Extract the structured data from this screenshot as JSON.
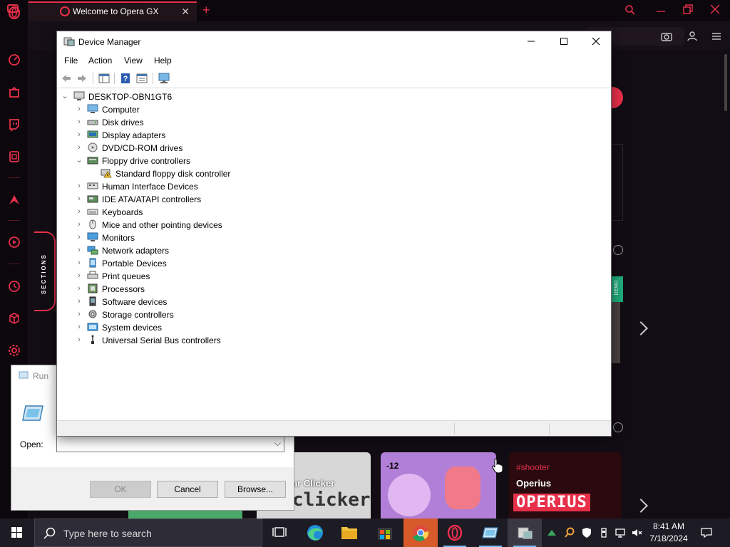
{
  "browser": {
    "tab_title": "Welcome to Opera GX",
    "sections_label": "SECTIONS",
    "demo_badge": "DEMO",
    "cards": [
      {
        "title": "ar Clicker",
        "logo_text": "clicker"
      },
      {
        "number": "-12"
      },
      {
        "tag": "#shooter",
        "title": "Operius",
        "logo_text": "OPERIUS"
      }
    ]
  },
  "device_manager": {
    "title": "Device Manager",
    "menu": [
      "File",
      "Action",
      "View",
      "Help"
    ],
    "tree": {
      "root": "DESKTOP-OBN1GT6",
      "items": [
        {
          "label": "Computer",
          "icon": "computer-icon",
          "expanded": false
        },
        {
          "label": "Disk drives",
          "icon": "disk-drive-icon",
          "expanded": false
        },
        {
          "label": "Display adapters",
          "icon": "display-adapter-icon",
          "expanded": false
        },
        {
          "label": "DVD/CD-ROM drives",
          "icon": "dvd-drive-icon",
          "expanded": false
        },
        {
          "label": "Floppy drive controllers",
          "icon": "floppy-controller-icon",
          "expanded": true
        },
        {
          "label": "Standard floppy disk controller",
          "icon": "warning-device-icon",
          "child": true
        },
        {
          "label": "Human Interface Devices",
          "icon": "hid-icon",
          "expanded": false
        },
        {
          "label": "IDE ATA/ATAPI controllers",
          "icon": "ide-controller-icon",
          "expanded": false
        },
        {
          "label": "Keyboards",
          "icon": "keyboard-icon",
          "expanded": false
        },
        {
          "label": "Mice and other pointing devices",
          "icon": "mouse-icon",
          "expanded": false
        },
        {
          "label": "Monitors",
          "icon": "monitor-icon",
          "expanded": false
        },
        {
          "label": "Network adapters",
          "icon": "network-adapter-icon",
          "expanded": false
        },
        {
          "label": "Portable Devices",
          "icon": "portable-device-icon",
          "expanded": false
        },
        {
          "label": "Print queues",
          "icon": "printer-icon",
          "expanded": false
        },
        {
          "label": "Processors",
          "icon": "processor-icon",
          "expanded": false
        },
        {
          "label": "Software devices",
          "icon": "software-device-icon",
          "expanded": false
        },
        {
          "label": "Storage controllers",
          "icon": "storage-controller-icon",
          "expanded": false
        },
        {
          "label": "System devices",
          "icon": "system-device-icon",
          "expanded": false
        },
        {
          "label": "Universal Serial Bus controllers",
          "icon": "usb-icon",
          "expanded": false
        }
      ]
    }
  },
  "run_dialog": {
    "title": "Run",
    "open_label": "Open:",
    "open_value": "",
    "ok": "OK",
    "cancel": "Cancel",
    "browse": "Browse..."
  },
  "taskbar": {
    "search_placeholder": "Type here to search",
    "time": "8:41 AM",
    "date": "7/18/2024",
    "apps": [
      "task-view-icon",
      "edge-icon",
      "file-explorer-icon",
      "store-icon",
      "chrome-icon",
      "opera-icon",
      "run-app-icon",
      "device-manager-app-icon"
    ]
  },
  "colors": {
    "gx_accent": "#e8304a",
    "taskbar_bg": "#1d1b24",
    "selection_underline": "#76b9ed"
  }
}
